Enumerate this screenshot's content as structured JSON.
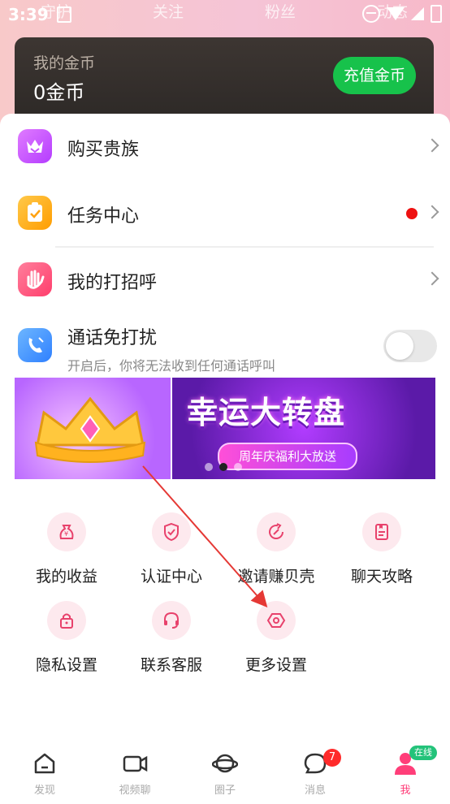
{
  "status_bar": {
    "time": "3:39"
  },
  "top_tabs": [
    "守护",
    "关注",
    "粉丝",
    "动态"
  ],
  "wallet": {
    "title": "我的金币",
    "amount": "0金币",
    "recharge_label": "充值金币"
  },
  "menu": [
    {
      "label": "购买贵族",
      "icon": "crown-icon",
      "color": "#c44dff"
    },
    {
      "label": "任务中心",
      "icon": "task-clipboard-icon",
      "color": "#ffb020",
      "has_dot": true
    },
    {
      "label": "我的打招呼",
      "icon": "wave-hand-icon",
      "color": "#ff4f7a"
    },
    {
      "label": "通话免打扰",
      "subtitle": "开启后，你将无法收到任何通话呼叫",
      "icon": "phone-icon",
      "color": "#3b8cff",
      "toggle_on": false
    }
  ],
  "banners": [
    {
      "name": "crown-banner"
    },
    {
      "title": "幸运大转盘",
      "subtitle": "周年庆福利大放送"
    }
  ],
  "grid": [
    {
      "label": "我的收益",
      "icon": "money-bag-icon"
    },
    {
      "label": "认证中心",
      "icon": "shield-check-icon"
    },
    {
      "label": "邀请赚贝壳",
      "icon": "invite-refresh-icon"
    },
    {
      "label": "聊天攻略",
      "icon": "guide-book-icon"
    },
    {
      "label": "隐私设置",
      "icon": "lock-icon"
    },
    {
      "label": "联系客服",
      "icon": "headset-icon"
    },
    {
      "label": "更多设置",
      "icon": "hexagon-settings-icon"
    }
  ],
  "bottom_nav": [
    {
      "label": "发现",
      "icon": "home-icon"
    },
    {
      "label": "视频聊",
      "icon": "video-icon"
    },
    {
      "label": "圈子",
      "icon": "planet-icon"
    },
    {
      "label": "消息",
      "icon": "chat-icon",
      "badge": "7"
    },
    {
      "label": "我",
      "icon": "person-icon",
      "badge": "在线",
      "active": true
    }
  ],
  "colors": {
    "accent": "#ff3e79",
    "green": "#17c24b",
    "arrow": "#e53935"
  }
}
